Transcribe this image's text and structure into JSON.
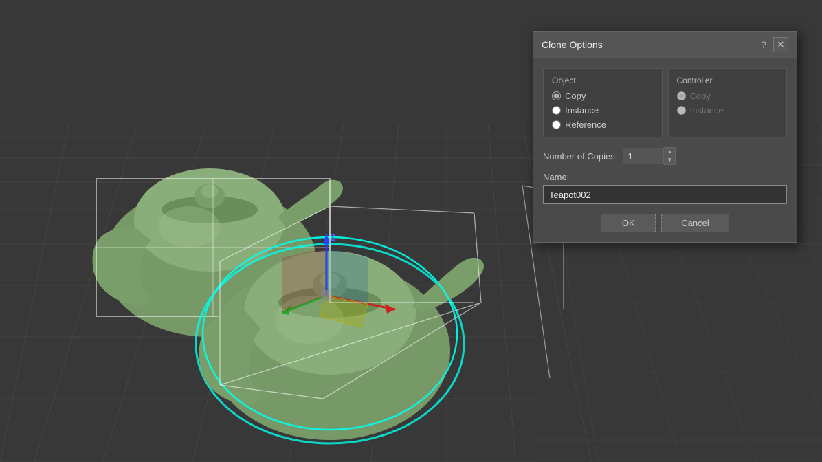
{
  "viewport": {
    "background": "#3a3a3a"
  },
  "dialog": {
    "title": "Clone Options",
    "help_label": "?",
    "close_label": "✕",
    "object_section": {
      "title": "Object",
      "options": [
        {
          "id": "copy",
          "label": "Copy",
          "checked": true
        },
        {
          "id": "instance",
          "label": "Instance",
          "checked": false
        },
        {
          "id": "reference",
          "label": "Reference",
          "checked": false
        }
      ]
    },
    "controller_section": {
      "title": "Controller",
      "options": [
        {
          "id": "ctrl-copy",
          "label": "Copy",
          "checked": true,
          "disabled": true
        },
        {
          "id": "ctrl-instance",
          "label": "Instance",
          "checked": false,
          "disabled": true
        }
      ]
    },
    "number_of_copies": {
      "label": "Number of Copies:",
      "value": "1"
    },
    "name_field": {
      "label": "Name:",
      "value": "Teapot002"
    },
    "ok_button": "OK",
    "cancel_button": "Cancel"
  }
}
